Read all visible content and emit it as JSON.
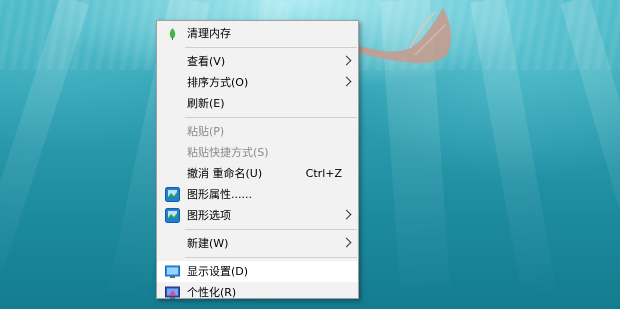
{
  "context_menu": {
    "items": [
      {
        "label": "清理内存",
        "icon": "leaf-icon"
      },
      {
        "label": "查看(V)",
        "submenu": true
      },
      {
        "label": "排序方式(O)",
        "submenu": true
      },
      {
        "label": "刷新(E)"
      },
      {
        "label": "粘贴(P)",
        "disabled": true
      },
      {
        "label": "粘贴快捷方式(S)",
        "disabled": true
      },
      {
        "label": "撤消 重命名(U)",
        "shortcut": "Ctrl+Z"
      },
      {
        "label": "图形属性......",
        "icon": "graphics-properties-icon"
      },
      {
        "label": "图形选项",
        "icon": "graphics-options-icon",
        "submenu": true
      },
      {
        "label": "新建(W)",
        "submenu": true
      },
      {
        "label": "显示设置(D)",
        "icon": "display-settings-icon",
        "highlighted": true
      },
      {
        "label": "个性化(R)",
        "icon": "personalize-icon"
      }
    ]
  },
  "colors": {
    "menu_bg": "#f2f2f2",
    "menu_border": "#a0a0a0",
    "highlight_bg": "#ffffff",
    "disabled_text": "#8a8a8a",
    "desktop_water": "#2e9fb1"
  }
}
